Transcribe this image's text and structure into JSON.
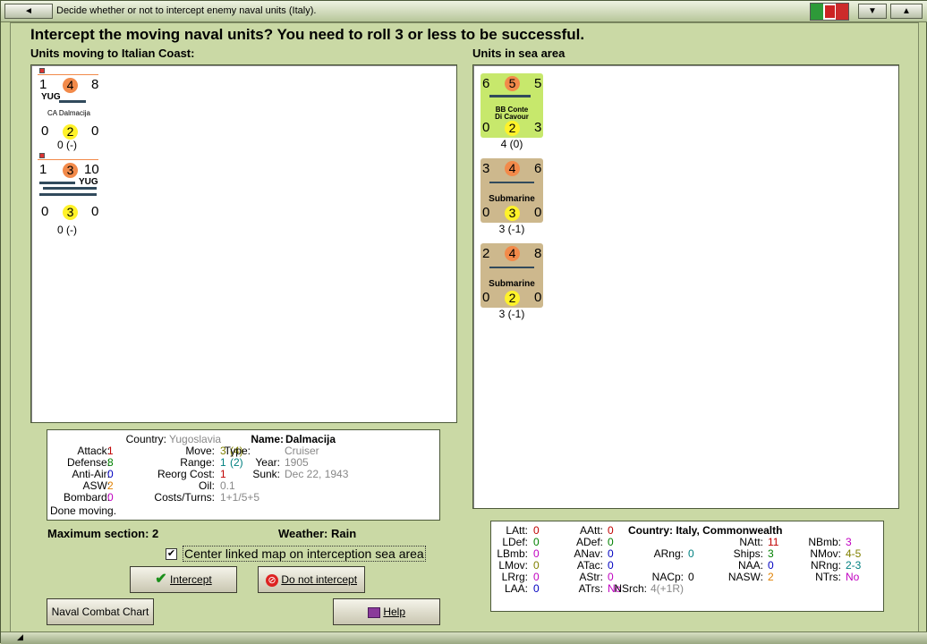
{
  "window": {
    "title": "Decide whether or not to intercept enemy naval units (Italy).",
    "flag_colors": [
      "#2e9a39",
      "#ffffff",
      "#cc2b2b"
    ]
  },
  "heading": "Intercept the moving naval units?  You need to roll 3 or less to be successful.",
  "left_header": "Units moving to Italian Coast:",
  "right_header": "Units in sea area",
  "moving_units": [
    {
      "top": [
        "1",
        "4",
        "8"
      ],
      "nation": "YUG",
      "name": "CA Dalmacija",
      "bottom": [
        "0",
        "2",
        "0"
      ],
      "sub": "0 (-)",
      "colors": {
        "mid": "#f28a4a",
        "def": "#fff22a"
      }
    },
    {
      "top": [
        "1",
        "3",
        "10"
      ],
      "nation": "YUG",
      "name": "",
      "bottom": [
        "0",
        "3",
        "0"
      ],
      "sub": "0 (-)",
      "colors": {
        "mid": "#f28a4a",
        "def": "#fff22a"
      }
    }
  ],
  "sea_units": [
    {
      "top": [
        "6",
        "5",
        "5"
      ],
      "name_line1": "BB Conte",
      "name_line2": "Di Cavour",
      "bottom": [
        "0",
        "2",
        "3"
      ],
      "sub": "4 (0)",
      "bg": "#c7e86c"
    },
    {
      "top": [
        "3",
        "4",
        "6"
      ],
      "name_line1": "Submarine",
      "name_line2": "",
      "bottom": [
        "0",
        "3",
        "0"
      ],
      "sub": "3 (-1)",
      "bg": "#cdb88d"
    },
    {
      "top": [
        "2",
        "4",
        "8"
      ],
      "name_line1": "Submarine",
      "name_line2": "",
      "bottom": [
        "0",
        "2",
        "0"
      ],
      "sub": "3 (-1)",
      "bg": "#cdb88d"
    }
  ],
  "unit_info": {
    "country_label": "Country:",
    "country": "Yugoslavia",
    "attack_label": "Attack:",
    "attack": "1",
    "defense_label": "Defense:",
    "defense": "8",
    "antiair_label": "Anti-Air:",
    "antiair": "0",
    "asw_label": "ASW:",
    "asw": "2",
    "bombard_label": "Bombard:",
    "bombard": "0",
    "status": "Done moving.",
    "name_label": "Name:",
    "name": "Dalmacija",
    "move_label": "Move:",
    "move": "3",
    "move_extra": "(4)",
    "type_label": "Type:",
    "type": "Cruiser",
    "range_label": "Range:",
    "range": "1",
    "range_extra": "(2)",
    "year_label": "Year:",
    "year": "1905",
    "reorg_label": "Reorg Cost:",
    "reorg": "1",
    "sunk_label": "Sunk:",
    "sunk": "Dec 22, 1943",
    "oil_label": "Oil:",
    "oil": "0.1",
    "costs_label": "Costs/Turns:",
    "costs": "1+1/5+5"
  },
  "max_section": "Maximum section: 2",
  "weather": "Weather:  Rain",
  "center_checkbox": {
    "label": "Center linked map on interception sea area",
    "checked": true
  },
  "buttons": {
    "intercept": "Intercept",
    "no_intercept": "Do not intercept",
    "chart": "Naval Combat Chart",
    "help": "Help"
  },
  "stats": {
    "country": "Country: Italy, Commonwealth",
    "col1": [
      [
        "LAtt:",
        "0"
      ],
      [
        "LDef:",
        "0"
      ],
      [
        "LBmb:",
        "0"
      ],
      [
        "LMov:",
        "0"
      ],
      [
        "LRrg:",
        "0"
      ],
      [
        "LAA:",
        "0"
      ]
    ],
    "col2": [
      [
        "AAtt:",
        "0"
      ],
      [
        "ADef:",
        "0"
      ],
      [
        "ANav:",
        "0"
      ],
      [
        "ATac:",
        "0"
      ],
      [
        "AStr:",
        "0"
      ],
      [
        "ATrs:",
        "No"
      ]
    ],
    "col3": [
      [
        "NAtt:",
        "11"
      ],
      [
        "Ships:",
        "3"
      ],
      [
        "NAA:",
        "0"
      ],
      [
        "NASW:",
        "2"
      ]
    ],
    "arng": [
      "ARng:",
      "0"
    ],
    "nacp": [
      "NACp:",
      "0"
    ],
    "nsrch": [
      "NSrch:",
      "4(+1R)"
    ],
    "col4": [
      [
        "NBmb:",
        "3"
      ],
      [
        "NMov:",
        "4-5"
      ],
      [
        "NRng:",
        "2-3"
      ],
      [
        "NTrs:",
        "No"
      ]
    ]
  }
}
